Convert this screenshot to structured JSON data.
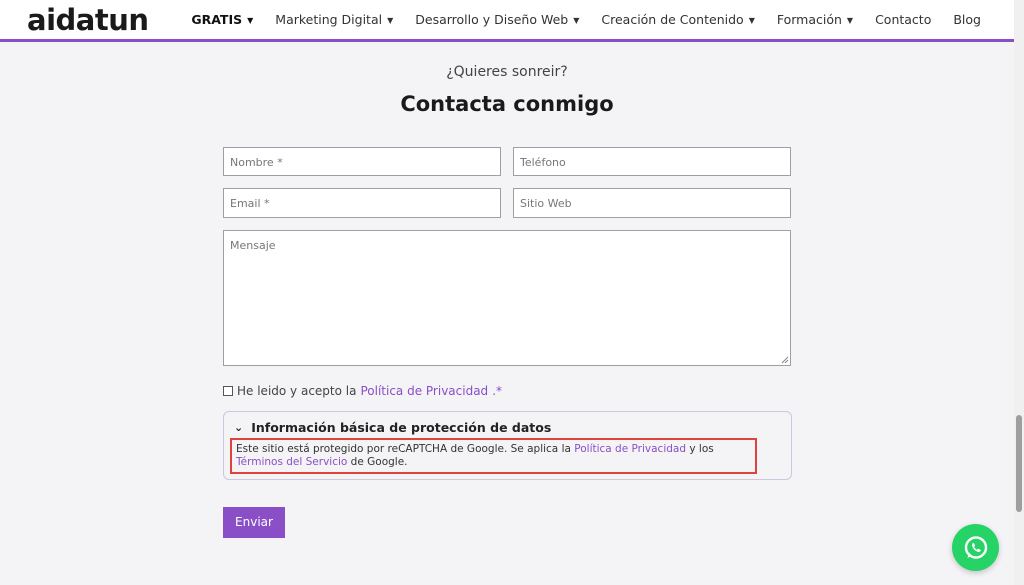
{
  "header": {
    "logo_text": "aidatun",
    "nav": [
      {
        "label": "GRATIS",
        "dropdown": true,
        "bold": true
      },
      {
        "label": "Marketing Digital",
        "dropdown": true
      },
      {
        "label": "Desarrollo y Diseño Web",
        "dropdown": true
      },
      {
        "label": "Creación de Contenido",
        "dropdown": true
      },
      {
        "label": "Formación",
        "dropdown": true
      },
      {
        "label": "Contacto",
        "dropdown": false
      },
      {
        "label": "Blog",
        "dropdown": false
      }
    ]
  },
  "contact": {
    "subtitle": "¿Quieres sonreir?",
    "title": "Contacta conmigo",
    "fields": {
      "name_placeholder": "Nombre *",
      "phone_placeholder": "Teléfono",
      "email_placeholder": "Email *",
      "website_placeholder": "Sitio Web",
      "message_placeholder": "Mensaje"
    },
    "consent": {
      "prefix": "He leido y acepto la ",
      "link": "Política de Privacidad",
      "suffix": ".*"
    },
    "info": {
      "heading": "Información básica de protección de datos",
      "text_1": "Este sitio está protegido por reCAPTCHA de Google. Se aplica la ",
      "link_1": "Política de Privacidad",
      "text_2": " y los ",
      "link_2": "Términos del Servicio",
      "text_3": " de Google."
    },
    "submit_label": "Enviar"
  },
  "colors": {
    "accent": "#8a4fc6",
    "highlight": "#e0433a",
    "whatsapp": "#25d366"
  }
}
